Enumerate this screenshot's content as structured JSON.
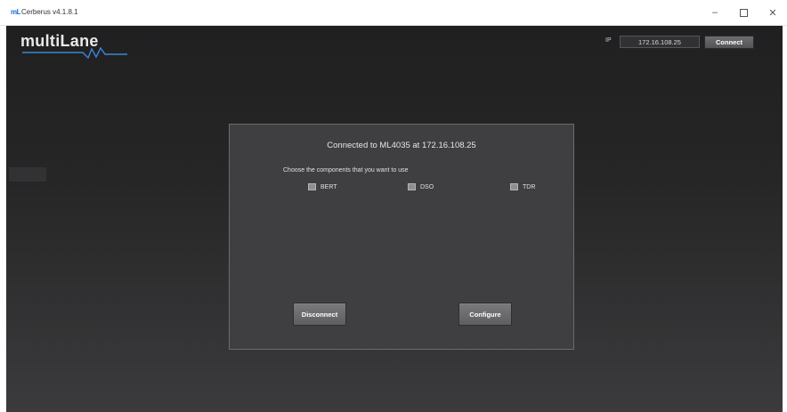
{
  "window": {
    "title": "Cerberus v4.1.8.1",
    "app_icon_text": "mL"
  },
  "header": {
    "logo_text": "multiLane",
    "ip_label": "IP",
    "ip_value": "172.16.108.25",
    "connect_label": "Connect"
  },
  "panel": {
    "status": "Connected to ML4035 at 172.16.108.25",
    "prompt": "Choose the components that you want to use",
    "components": [
      {
        "label": "BERT",
        "checked": false
      },
      {
        "label": "DSO",
        "checked": false
      },
      {
        "label": "TDR",
        "checked": false
      }
    ],
    "disconnect_label": "Disconnect",
    "configure_label": "Configure"
  },
  "colors": {
    "background_top": "#202021",
    "background_bottom": "#3b3b3d",
    "panel": "#3f3f41",
    "logo_wave": "#3a86d6"
  }
}
